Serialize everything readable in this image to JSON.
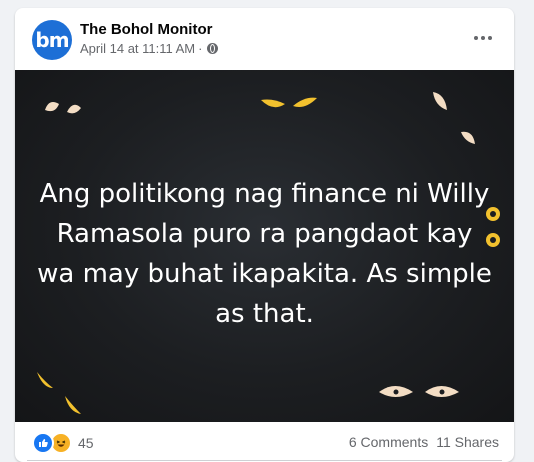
{
  "post": {
    "page_name": "The Bohol Monitor",
    "avatar_text": "bm",
    "timestamp": "April 14 at 11:11 AM",
    "separator": "·",
    "privacy_icon": "globe-icon",
    "menu_icon": "more-options-icon",
    "body_text": "Ang politikong nag finance ni Willy Ramasola puro ra pangdaot kay wa may buhat ikapakita. As simple as that."
  },
  "engagement": {
    "reaction_icons": [
      "like-icon",
      "haha-icon"
    ],
    "reaction_count": "45",
    "comments": "6 Comments",
    "shares": "11 Shares"
  },
  "colors": {
    "brand_blue": "#1d6fd6",
    "like_blue": "#1877f2",
    "haha_yellow": "#f7b125",
    "image_bg": "#1c1e21",
    "eye_yellow": "#f2c12e",
    "eye_cream": "#f3ddc4"
  }
}
